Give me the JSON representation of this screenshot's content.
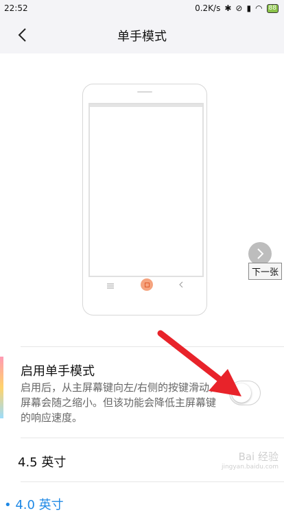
{
  "status_bar": {
    "time": "22:52",
    "speed": "0.2K/s",
    "battery": "88"
  },
  "header": {
    "title": "单手模式"
  },
  "preview": {
    "next_tooltip": "下一张"
  },
  "setting": {
    "title": "启用单手模式",
    "description": "启用后，从主屏幕键向左/右侧的按键滑动，屏幕会随之缩小。但该功能会降低主屏幕键的响应速度。",
    "enabled": false
  },
  "options": [
    {
      "label": "4.5 英寸",
      "selected": false
    },
    {
      "label": "• 4.0 英寸",
      "selected": true
    }
  ],
  "watermark": {
    "text": "Bai 经验",
    "sub": "jingyan.baidu.com"
  },
  "colors": {
    "accent": "#1e88e5",
    "annotation_arrow": "#e8232a"
  }
}
